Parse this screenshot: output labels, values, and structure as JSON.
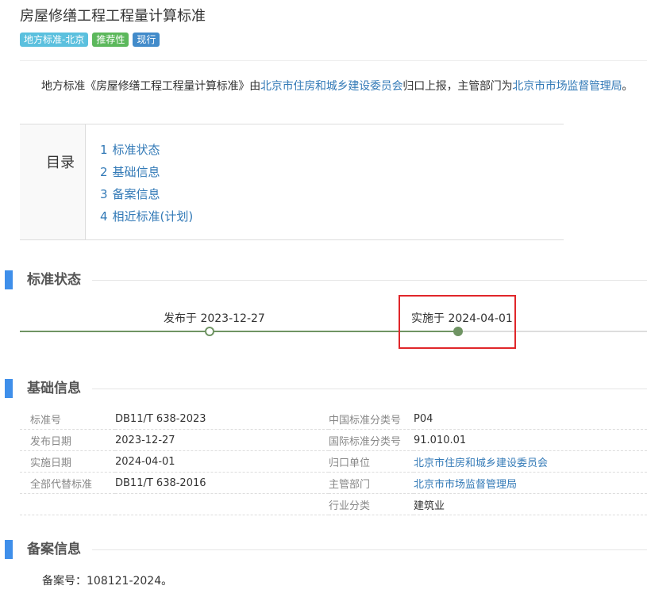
{
  "title": "房屋修缮工程工程量计算标准",
  "badges": [
    "地方标准-北京",
    "推荐性",
    "现行"
  ],
  "intro": {
    "prefix": "地方标准《房屋修缮工程工程量计算标准》由",
    "org1": "北京市住房和城乡建设委员会",
    "middle": "归口上报，主管部门为",
    "org2": "北京市市场监督管理局",
    "suffix": "。"
  },
  "toc": {
    "heading": "目录",
    "items": [
      {
        "num": "1",
        "label": "标准状态"
      },
      {
        "num": "2",
        "label": "基础信息"
      },
      {
        "num": "3",
        "label": "备案信息"
      },
      {
        "num": "4",
        "label": "相近标准(计划)"
      }
    ]
  },
  "status": {
    "title": "标准状态",
    "published_label": "发布于 2023-12-27",
    "implemented_label": "实施于 2024-04-01",
    "accent_color": "#6f9463",
    "highlight_color": "#e0262a"
  },
  "basic": {
    "title": "基础信息",
    "rows": [
      {
        "k1": "标准号",
        "v1": "DB11/T 638-2023",
        "k2": "中国标准分类号",
        "v2": "P04"
      },
      {
        "k1": "发布日期",
        "v1": "2023-12-27",
        "k2": "国际标准分类号",
        "v2": "91.010.01"
      },
      {
        "k1": "实施日期",
        "v1": "2024-04-01",
        "k2": "归口单位",
        "v2": "北京市住房和城乡建设委员会"
      },
      {
        "k1": "全部代替标准",
        "v1": "DB11/T 638-2016",
        "k2": "主管部门",
        "v2": "北京市市场监督管理局"
      },
      {
        "k1": "",
        "v1": "",
        "k2": "行业分类",
        "v2": "建筑业"
      }
    ]
  },
  "filing": {
    "title": "备案信息",
    "text": "备案号：108121-2024。"
  }
}
